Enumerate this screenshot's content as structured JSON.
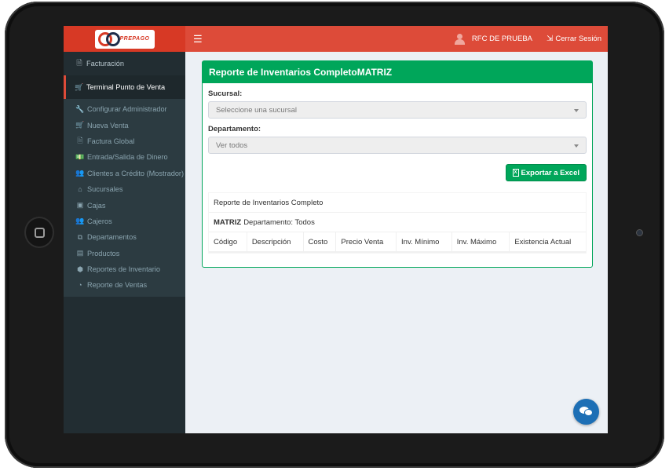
{
  "brand": {
    "logo_text": "PREPAGO"
  },
  "navbar": {
    "menu_icon": "☰",
    "user_name": "RFC DE PRUEBA",
    "logout_label": "Cerrar Sesión"
  },
  "sidebar": {
    "facturacion": "Facturación",
    "terminal": "Terminal Punto de Venta",
    "items": [
      {
        "label": "Configurar Administrador",
        "icon": "wrench-icon",
        "glyph": "🔧"
      },
      {
        "label": "Nueva Venta",
        "icon": "cart-icon",
        "glyph": "🛒"
      },
      {
        "label": "Factura Global",
        "icon": "document-icon",
        "glyph": "🗎"
      },
      {
        "label": "Entrada/Salida de Dinero",
        "icon": "money-icon",
        "glyph": "💵"
      },
      {
        "label": "Clientes a Crédito (Mostrador)",
        "icon": "users-icon",
        "glyph": "👥"
      },
      {
        "label": "Sucursales",
        "icon": "home-icon",
        "glyph": "⌂"
      },
      {
        "label": "Cajas",
        "icon": "inbox-icon",
        "glyph": "▣"
      },
      {
        "label": "Cajeros",
        "icon": "users-icon",
        "glyph": "👥"
      },
      {
        "label": "Departamentos",
        "icon": "sitemap-icon",
        "glyph": "⧉"
      },
      {
        "label": "Productos",
        "icon": "box-icon",
        "glyph": "▤"
      },
      {
        "label": "Reportes de Inventario",
        "icon": "cube-icon",
        "glyph": "⬢"
      },
      {
        "label": "Reporte de Ventas",
        "icon": "pie-chart-icon",
        "glyph": "◔"
      }
    ]
  },
  "box": {
    "title": "Reporte de Inventarios CompletoMATRIZ",
    "sucursal_label": "Sucursal:",
    "sucursal_placeholder": "Seleccione una sucursal",
    "departamento_label": "Departamento:",
    "departamento_value": "Ver todos",
    "export_label": "Exportar a Excel"
  },
  "report": {
    "title": "Reporte de Inventarios Completo",
    "branch": "MATRIZ",
    "department_text": "Departamento: Todos",
    "columns": [
      "Código",
      "Descripción",
      "Costo",
      "Precio Venta",
      "Inv. Mínimo",
      "Inv. Máximo",
      "Existencia Actual"
    ]
  },
  "colors": {
    "navbar": "#dd4b39",
    "sidebar": "#222d32",
    "accent_green": "#00a65a",
    "chat_button": "#1d6fb5"
  }
}
